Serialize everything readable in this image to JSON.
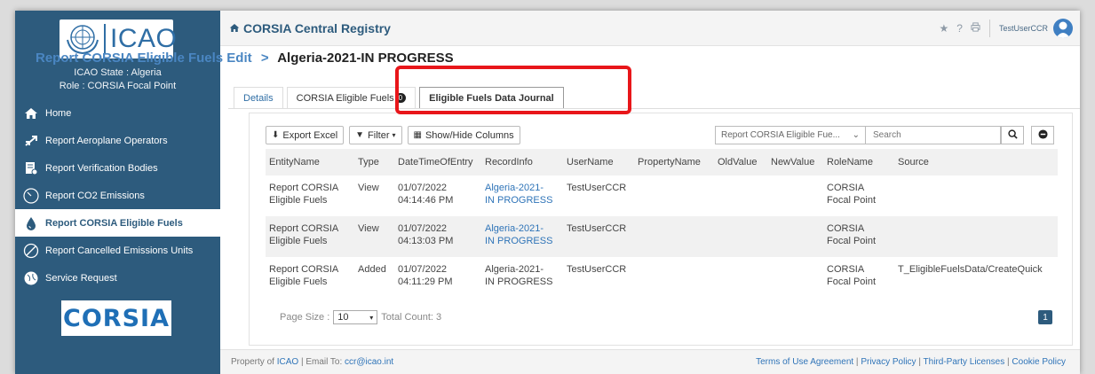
{
  "sidebar": {
    "logo_text": "ICAO",
    "state_line": "ICAO State : Algeria",
    "role_line": "Role : CORSIA Focal Point",
    "items": [
      {
        "label": "Home"
      },
      {
        "label": "Report Aeroplane Operators"
      },
      {
        "label": "Report Verification Bodies"
      },
      {
        "label": "Report CO2 Emissions"
      },
      {
        "label": "Report CORSIA Eligible Fuels"
      },
      {
        "label": "Report Cancelled Emissions Units"
      },
      {
        "label": "Service Request"
      }
    ],
    "corsia_logo": "CORSIA"
  },
  "header": {
    "title": "CORSIA Central Registry",
    "username": "TestUserCCR"
  },
  "breadcrumb": {
    "parent": "Report CORSIA Eligible Fuels Edit",
    "separator": ">",
    "current": "Algeria-2021-IN PROGRESS"
  },
  "tabs": [
    {
      "label": "Details"
    },
    {
      "label": "CORSIA Eligible Fuels",
      "badge": "0"
    },
    {
      "label": "Eligible Fuels Data Journal"
    }
  ],
  "toolbar": {
    "export_label": "Export Excel",
    "filter_label": "Filter",
    "columns_label": "Show/Hide Columns",
    "entity_select": "Report CORSIA Eligible Fue...",
    "search_placeholder": "Search"
  },
  "table": {
    "columns": [
      "EntityName",
      "Type",
      "DateTimeOfEntry",
      "RecordInfo",
      "UserName",
      "PropertyName",
      "OldValue",
      "NewValue",
      "RoleName",
      "Source"
    ],
    "rows": [
      {
        "entity1": "Report CORSIA",
        "entity2": "Eligible Fuels",
        "type": "View",
        "date1": "01/07/2022",
        "date2": "04:14:46 PM",
        "rec1": "Algeria-2021-",
        "rec2": "IN PROGRESS",
        "user": "TestUserCCR",
        "property": "",
        "old": "",
        "new": "",
        "role1": "CORSIA",
        "role2": "Focal Point",
        "source": ""
      },
      {
        "entity1": "Report CORSIA",
        "entity2": "Eligible Fuels",
        "type": "View",
        "date1": "01/07/2022",
        "date2": "04:13:03 PM",
        "rec1": "Algeria-2021-",
        "rec2": "IN PROGRESS",
        "user": "TestUserCCR",
        "property": "",
        "old": "",
        "new": "",
        "role1": "CORSIA",
        "role2": "Focal Point",
        "source": ""
      },
      {
        "entity1": "Report CORSIA",
        "entity2": "Eligible Fuels",
        "type": "Added",
        "date1": "01/07/2022",
        "date2": "04:11:29 PM",
        "rec1": "Algeria-2021-",
        "rec2": "IN PROGRESS",
        "user": "TestUserCCR",
        "property": "",
        "old": "",
        "new": "",
        "role1": "CORSIA",
        "role2": "Focal Point",
        "source": "T_EligibleFuelsData/CreateQuick"
      }
    ]
  },
  "pager": {
    "size_label": "Page Size :",
    "size_value": "10",
    "total_label": "Total Count: 3",
    "current_page": "1"
  },
  "footer": {
    "prefix": "Property of",
    "org": "ICAO",
    "email_label": "| Email To:",
    "email": "ccr@icao.int",
    "links": [
      "Terms of Use Agreement",
      "Privacy Policy",
      "Third-Party Licenses",
      "Cookie Policy"
    ]
  },
  "colors": {
    "sidebar_bg": "#2d5b7d",
    "accent": "#2f74b8",
    "highlight": "#e8161a"
  }
}
